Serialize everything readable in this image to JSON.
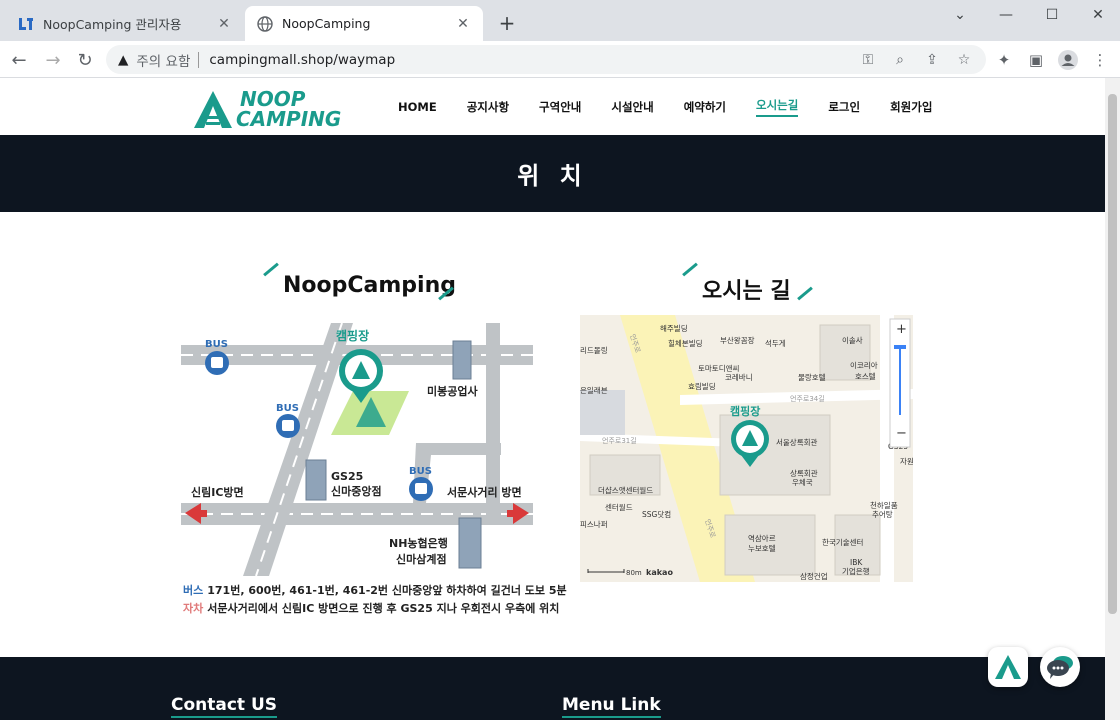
{
  "browser": {
    "tabs": [
      {
        "title": "NoopCamping 관리자용"
      },
      {
        "title": "NoopCamping"
      }
    ],
    "omnibox": {
      "warning": "주의 요함",
      "url": "campingmall.shop/waymap"
    }
  },
  "site": {
    "logo": {
      "line1": "NOOP",
      "line2": "CAMPING"
    },
    "menu": [
      "HOME",
      "공지사항",
      "구역안내",
      "시설안내",
      "예약하기",
      "오시는길",
      "로그인",
      "회원가입"
    ],
    "active_menu": "오시는길",
    "banner_title": "위 치"
  },
  "left_section": {
    "title": "NoopCamping",
    "map_labels": {
      "camp": "캠핑장",
      "bus1": "BUS",
      "bus2": "BUS",
      "bus3": "BUS",
      "mibong": "미봉공업사",
      "gs25_line1": "GS25",
      "gs25_line2": "신마중앙점",
      "sillim": "신림IC방면",
      "seomun": "서문사거리 방면",
      "nh_line1": "NH농협은행",
      "nh_line2": "신마삼계점"
    },
    "captions": [
      {
        "kind": "버스",
        "kind_color": "#2f6db5",
        "text": "171번, 600번, 461-1번, 461-2번 신마중앙앞 하차하여 길건너 도보 5분"
      },
      {
        "kind": "자차",
        "kind_color": "#e07a7a",
        "text": "서문사거리에서 신림IC 방면으로 진행 후 GS25 지나 우회전시 우측에 위치"
      }
    ]
  },
  "right_section": {
    "title": "오시는 길",
    "kakao_map": {
      "camp_label": "캠핑장",
      "labels": [
        "해주빌딩",
        "부산왕꼼장",
        "석두게",
        "이솔사",
        "리드몰링",
        "힐체본빌딩",
        "토마토디앤씨",
        "코레바니",
        "물랑호텔",
        "이코리아",
        "호스텔",
        "은일래븐",
        "효림빌딩",
        "서울상록회관",
        "상록회관",
        "우체국",
        "더샵스앳센터월드",
        "센터월드",
        "SSG닷컴",
        "피스나퍼",
        "역삼아르",
        "누보호텔",
        "한국기술센터",
        "천하일품",
        "추어탕",
        "IBK",
        "기업은행",
        "삼정건업",
        "GS25",
        "자원"
      ],
      "road_labels": [
        "언주로",
        "언주로31길",
        "언주로34길",
        "언주로"
      ],
      "zoom_in": "+",
      "zoom_out": "−",
      "scale": "80m",
      "brand": "kakao"
    }
  },
  "footer": {
    "contact": "Contact US",
    "menu_link": "Menu Link"
  },
  "colors": {
    "accent": "#1a9b8c",
    "dark": "#0d1520",
    "bus_blue": "#2f6db5",
    "arrow_red": "#d9393a"
  }
}
